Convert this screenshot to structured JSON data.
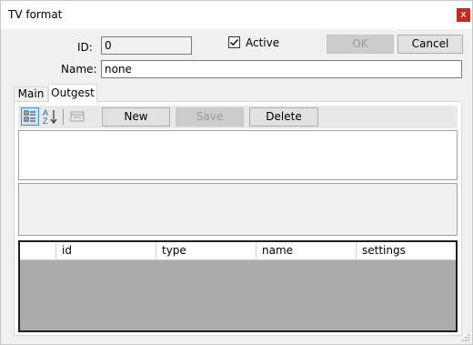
{
  "window": {
    "title": "TV format",
    "close_label": "x"
  },
  "form": {
    "id_label": "ID:",
    "id_value": "0",
    "name_label": "Name:",
    "name_value": "none",
    "active_label": "Active",
    "active_checked": true
  },
  "buttons": {
    "ok": "OK",
    "cancel": "Cancel"
  },
  "tabs": [
    {
      "label": "Main",
      "active": false
    },
    {
      "label": "Outgest",
      "active": true
    }
  ],
  "toolbar": {
    "new": "New",
    "save": "Save",
    "delete": "Delete",
    "icons": [
      "categorized-icon",
      "sort-alphabetical-icon",
      "property-pages-icon"
    ]
  },
  "grid": {
    "columns": [
      "",
      "id",
      "type",
      "name",
      "settings"
    ],
    "body_color": "#ababab"
  },
  "colors": {
    "close_button": "#c42b1c",
    "selected_tool": "#cce4f7"
  }
}
